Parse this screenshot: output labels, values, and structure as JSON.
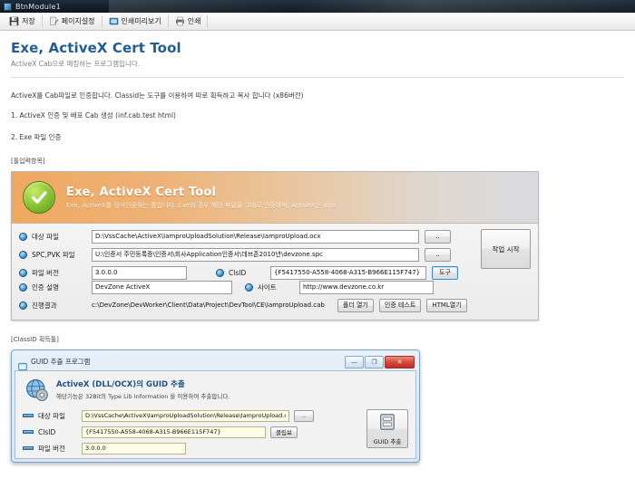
{
  "window": {
    "title": "BtnModule1",
    "icon": "app-window-icon"
  },
  "toolbar": {
    "items": [
      {
        "label": "저장",
        "icon": "save-icon"
      },
      {
        "label": "페이지설정",
        "icon": "page-setup-icon"
      },
      {
        "label": "인쇄미리보기",
        "icon": "print-preview-icon"
      },
      {
        "label": "인쇄",
        "icon": "print-icon"
      }
    ]
  },
  "document": {
    "title": "Exe, ActiveX Cert Tool",
    "subtitle": "ActiveX Cab으로 패킹하는 프로그램입니다.",
    "intro": "ActiveX를 Cab파일로 인증합니다. Classid는 도구를 이용하여 따로 획득하고 복사 합니다 (x86버전)",
    "steps": [
      "1. ActiveX 인증 및 배포 Cab 생성 (inf.cab.test html)",
      "2. Exe 파일 인증"
    ],
    "section_tool_inputs": "[툴입력항목]",
    "section_classid": "[ClassID 획득툴]"
  },
  "tool_panel": {
    "banner": {
      "title": "Exe, ActiveX Cert Tool",
      "desc": "Exe, ActiveX를 정식인증하는 툴입니다. Exe의 경우 해당 파일을 그대로 인증하며, ActiveX는 info.",
      "icon": "check-circle-icon"
    },
    "fields": {
      "target_file": {
        "label": "대상 파일",
        "value": "D:\\VssCache\\ActiveX\\IamproUploadSolution\\Release\\IamproUpload.ocx",
        "browse": ".."
      },
      "spc_pvk_file": {
        "label": "SPC,PVK 파일",
        "value": "U:\\인증서 주민등록증\\인증서\\회사Application인증서\\데브존2010년\\devzone.spc",
        "browse": ".."
      },
      "file_version": {
        "label": "파일 버전",
        "value": "3.0.0.0"
      },
      "clsid": {
        "label": "ClsID",
        "value": "{F5417550-A558-4068-A315-B966E115F747}",
        "tool_button": "도구"
      },
      "cert_desc": {
        "label": "인증 설명",
        "value": "DevZone ActiveX"
      },
      "site": {
        "label": "사이트",
        "value": "http://www.devzone.co.kr"
      },
      "progress_result": {
        "label": "진행결과",
        "value": "c:\\DevZone\\DevWorker\\Client\\Data\\Project\\DevTool\\CE\\IamproUpload.cab"
      }
    },
    "buttons": {
      "start": "작업 시작",
      "open_folder": "폴더 열기",
      "cert_test": "인증 테스트",
      "open_html": "HTML열기"
    }
  },
  "guid_dialog": {
    "title": "GUID 추출 프로그램",
    "title_icon": "app-window-icon",
    "window_buttons": {
      "minimize": "—",
      "maximize": "❐",
      "close": "✕"
    },
    "header": {
      "title": "ActiveX (DLL/OCX)의 GUID 추출",
      "desc": "해당기능은 32Bit의 Type Lib Information 을 이용하여 추출합니다.",
      "icon": "globe-gear-icon"
    },
    "fields": {
      "target_file": {
        "label": "대상 파일",
        "value": "D:\\VssCache\\ActiveX\\IamproUploadSolution\\Release\\IamproUpload.ocx",
        "browse": ".."
      },
      "clsid": {
        "label": "ClsID",
        "value": "{F5417550-A558-4068-A315-B966E115F747}",
        "copy_button": "클립보"
      },
      "file_version": {
        "label": "파일 버전",
        "value": "3.0.0.0"
      }
    },
    "extract_button": {
      "label": "GUID 추출",
      "icon": "extract-icon"
    }
  }
}
